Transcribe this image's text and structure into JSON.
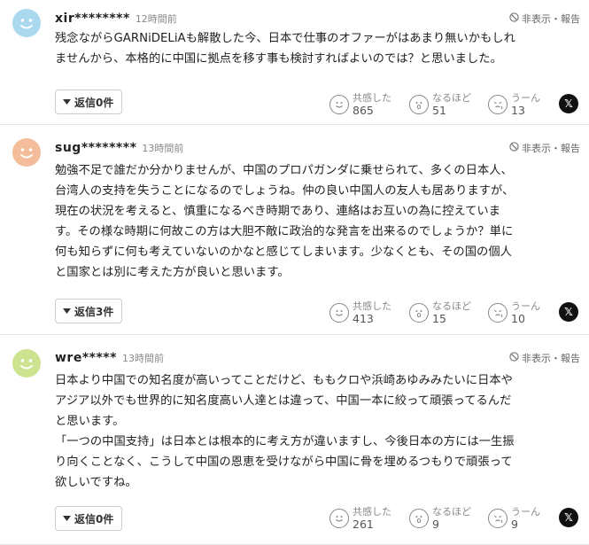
{
  "common": {
    "hide_report": "非表示・報告",
    "reactions": {
      "empathy": "共感した",
      "understood": "なるほど",
      "hmm": "うーん"
    },
    "share_x": "𝕏"
  },
  "comments": [
    {
      "user": "xir********",
      "time": "12時間前",
      "avatar_color": "#a9d8ef",
      "lines": [
        "残念ながらGARNiDELiAも解散した今、日本で仕事のオファーがはあまり無いかもしれ",
        "ませんから、本格的に中国に拠点を移す事も検討すればよいのでは？と思いました。"
      ],
      "reply": "返信0件",
      "empathy": "865",
      "understood": "51",
      "hmm": "13"
    },
    {
      "user": "sug********",
      "time": "13時間前",
      "avatar_color": "#f3bd9b",
      "lines": [
        "勉強不足で誰だか分かりませんが、中国のプロパガンダに乗せられて、多くの日本人、",
        "台湾人の支持を失うことになるのでしょうね。仲の良い中国人の友人も居ありますが、",
        "現在の状況を考えると、慎重になるべき時期であり、連絡はお互いの為に控えていま",
        "す。その様な時期に何故この方は大胆不敵に政治的な発言を出来るのでしょうか？単に",
        "何も知らずに何も考えていないのかなと感じてしまいます。少なくとも、その国の個人",
        "と国家とは別に考えた方が良いと思います。"
      ],
      "reply": "返信3件",
      "empathy": "413",
      "understood": "15",
      "hmm": "10"
    },
    {
      "user": "wre*****",
      "time": "13時間前",
      "avatar_color": "#cde38f",
      "lines": [
        "日本より中国での知名度が高いってことだけど、ももクロや浜崎あゆみみたいに日本や",
        "アジア以外でも世界的に知名度高い人達とは違って、中国一本に絞って頑張ってるんだ",
        "と思います。",
        "「一つの中国支持」は日本とは根本的に考え方が違いますし、今後日本の方には一生振",
        "り向くことなく、こうして中国の恩恵を受けながら中国に骨を埋めるつもりで頑張って",
        "欲しいですね。"
      ],
      "reply": "返信0件",
      "empathy": "261",
      "understood": "9",
      "hmm": "9"
    }
  ]
}
